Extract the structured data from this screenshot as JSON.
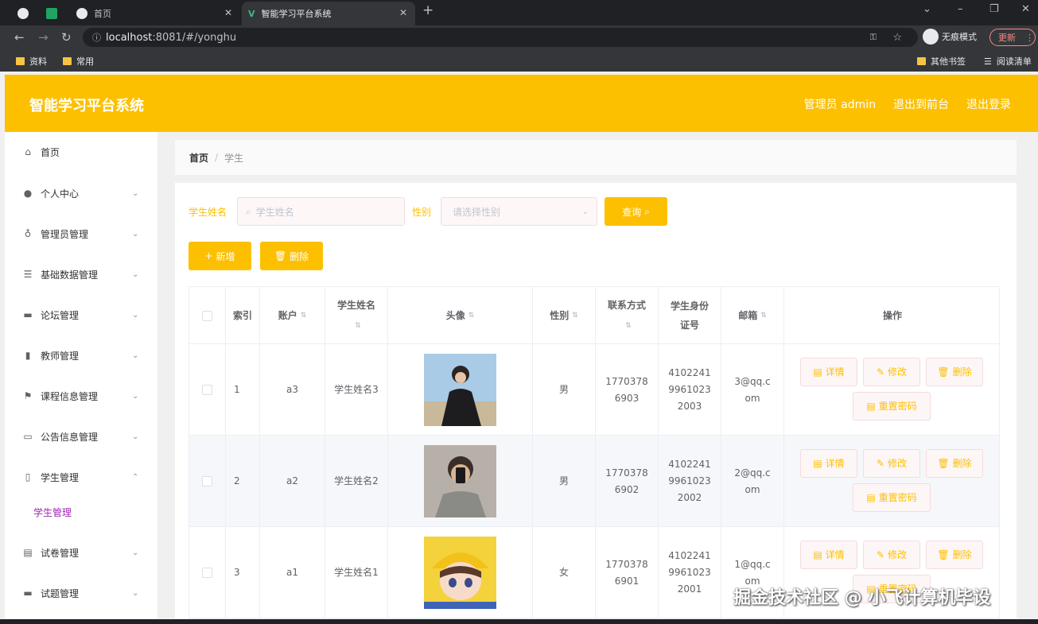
{
  "browser": {
    "tabs": [
      {
        "title": "首页"
      },
      {
        "title": "智能学习平台系统"
      }
    ],
    "url_host": "localhost",
    "url_rest": ":8081/#/yonghu",
    "incognito_label": "无痕模式",
    "update_label": "更新",
    "bookmarks": [
      "资料",
      "常用",
      "其他书签",
      "阅读清单"
    ]
  },
  "header": {
    "title": "智能学习平台系统",
    "admin_label": "管理员 admin",
    "front_link": "退出到前台",
    "logout_link": "退出登录"
  },
  "sidebar": {
    "items": [
      {
        "label": "首页",
        "icon": "home-icon"
      },
      {
        "label": "个人中心",
        "icon": "user-icon"
      },
      {
        "label": "管理员管理",
        "icon": "microphone-icon"
      },
      {
        "label": "基础数据管理",
        "icon": "list-icon"
      },
      {
        "label": "论坛管理",
        "icon": "monitor-icon"
      },
      {
        "label": "教师管理",
        "icon": "bar-chart-icon"
      },
      {
        "label": "课程信息管理",
        "icon": "flag-icon"
      },
      {
        "label": "公告信息管理",
        "icon": "message-icon"
      },
      {
        "label": "学生管理",
        "icon": "phone-icon"
      },
      {
        "label": "试卷管理",
        "icon": "chart-icon"
      },
      {
        "label": "试题管理",
        "icon": "screen-icon"
      }
    ],
    "sub_item": "学生管理"
  },
  "breadcrumb": {
    "home": "首页",
    "sep": "/",
    "current": "学生"
  },
  "search": {
    "name_label": "学生姓名",
    "name_placeholder": "学生姓名",
    "gender_label": "性别",
    "gender_placeholder": "请选择性别",
    "query_button": "查询"
  },
  "actions": {
    "add": "新增",
    "delete": "删除"
  },
  "table": {
    "headers": [
      "索引",
      "账户",
      "学生姓名",
      "头像",
      "性别",
      "联系方式",
      "学生身份证号",
      "邮箱",
      "操作"
    ],
    "rows": [
      {
        "index": "1",
        "account": "a3",
        "name": "学生姓名3",
        "gender": "男",
        "phone": "17703786903",
        "id_card": "410224199610232003",
        "email": "3@qq.com"
      },
      {
        "index": "2",
        "account": "a2",
        "name": "学生姓名2",
        "gender": "男",
        "phone": "17703786902",
        "id_card": "410224199610232002",
        "email": "2@qq.com"
      },
      {
        "index": "3",
        "account": "a1",
        "name": "学生姓名1",
        "gender": "女",
        "phone": "17703786901",
        "id_card": "410224199610232001",
        "email": "1@qq.com"
      }
    ],
    "ops": {
      "detail": "详情",
      "edit": "修改",
      "delete": "删除",
      "reset": "重置密码"
    }
  },
  "watermark": "掘金技术社区 @ 小飞计算机毕设"
}
